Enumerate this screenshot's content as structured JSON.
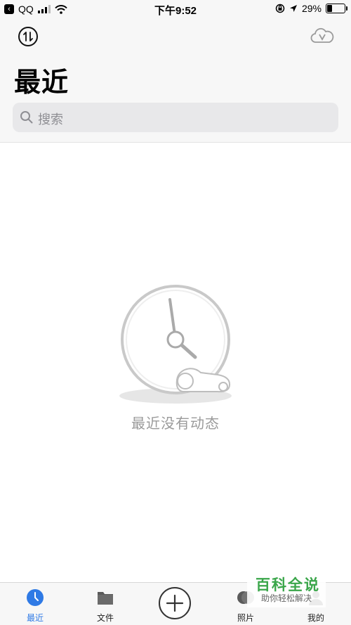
{
  "status_bar": {
    "back_app": "QQ",
    "time": "下午9:52",
    "battery": "29%"
  },
  "header": {
    "title": "最近",
    "search_placeholder": "搜索"
  },
  "empty_state": {
    "message": "最近没有动态"
  },
  "tabs": [
    {
      "label": "最近",
      "icon": "clock-icon",
      "active": true
    },
    {
      "label": "文件",
      "icon": "folder-icon",
      "active": false
    },
    {
      "label": "照片",
      "icon": "photo-icon",
      "active": false
    },
    {
      "label": "我的",
      "icon": "profile-icon",
      "active": false
    }
  ],
  "watermark": {
    "title": "百科全说",
    "subtitle": "助你轻松解决"
  },
  "colors": {
    "accent": "#2f7ae5",
    "watermark_green": "#3aa64a",
    "header_bg": "#f7f7f7",
    "search_bg": "#e8e8ea"
  }
}
